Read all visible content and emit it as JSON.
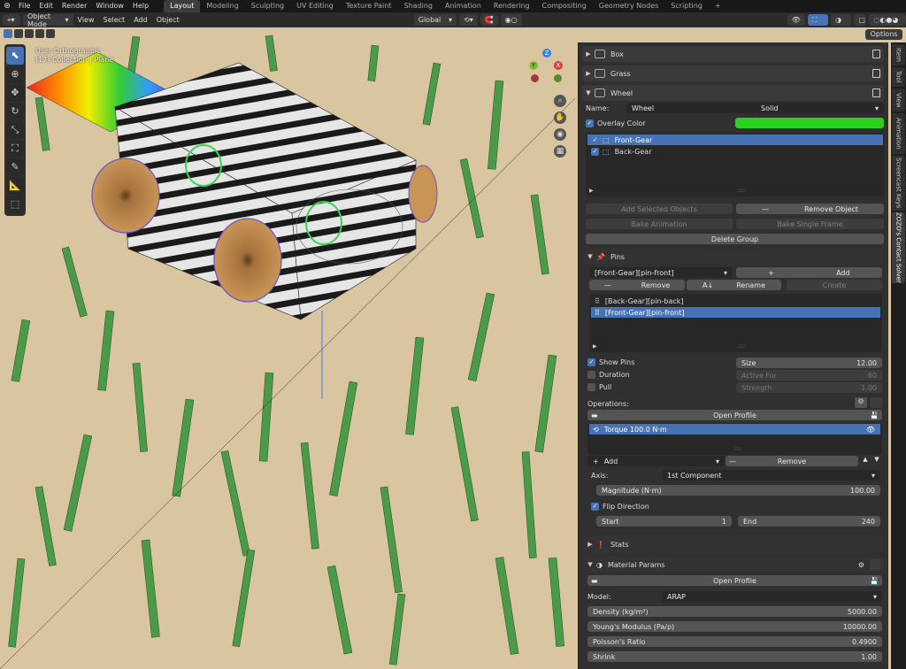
{
  "menubar": {
    "menus": [
      "File",
      "Edit",
      "Render",
      "Window",
      "Help"
    ],
    "workspaces": [
      "Layout",
      "Modeling",
      "Sculpting",
      "UV Editing",
      "Texture Paint",
      "Shading",
      "Animation",
      "Rendering",
      "Compositing",
      "Geometry Nodes",
      "Scripting"
    ],
    "active_workspace": "Layout",
    "add_tab": "+"
  },
  "header": {
    "mode": "Object Mode",
    "menus": [
      "View",
      "Select",
      "Add",
      "Object"
    ],
    "orientation": "Global",
    "options": "Options"
  },
  "viewport": {
    "view_name": "User Orthographic",
    "collection": "(17) Collection | Plane",
    "gizmo": {
      "x": "X",
      "y": "Y",
      "z": "Z"
    },
    "colors": {
      "ground": "#d9c6a0",
      "grass": "#3f8f3f",
      "wood": "#b8874e",
      "selection": "#39d353"
    }
  },
  "right_tabs": [
    "Item",
    "Tool",
    "View",
    "Animation",
    "Screencast Keys",
    "ZOZO's Contact Solver"
  ],
  "panel": {
    "groups": [
      {
        "label": "Box"
      },
      {
        "label": "Grass"
      },
      {
        "label": "Wheel"
      }
    ],
    "name_label": "Name:",
    "name_value": "Wheel",
    "shading_value": "Solid",
    "overlay_label": "Overlay Color",
    "overlay_color": "#2bd11c",
    "objects": [
      {
        "label": "Front-Gear",
        "selected": true
      },
      {
        "label": "Back-Gear",
        "selected": false
      }
    ],
    "list_grip": "::::",
    "add_selected": "Add Selected Objects",
    "remove_object": "Remove Object",
    "bake_animation": "Bake Animation",
    "bake_single": "Bake Single Frame",
    "delete_group": "Delete Group",
    "pins": {
      "title": "Pins",
      "selected": "[Front-Gear][pin-front]",
      "add": "Add",
      "remove": "Remove",
      "rename": "Rename",
      "create": "Create",
      "items": [
        {
          "label": "[Back-Gear][pin-back]",
          "selected": false
        },
        {
          "label": "[Front-Gear][pin-front]",
          "selected": true
        }
      ]
    },
    "show_pins": "Show Pins",
    "size_label": "Size",
    "size_value": "12.00",
    "duration": "Duration",
    "active_for": "Active For",
    "active_for_value": "60",
    "pull": "Pull",
    "strength": "Strength",
    "strength_value": "1.00",
    "operations_label": "Operations:",
    "open_profile": "Open Profile",
    "operation": "Torque 100.0 N·m",
    "op_add": "Add",
    "op_remove": "Remove",
    "axis_label": "Axis:",
    "axis_value": "1st Component",
    "magnitude_label": "Magnitude (N·m)",
    "magnitude_value": "100.00",
    "flip": "Flip Direction",
    "start_label": "Start",
    "start_value": "1",
    "end_label": "End",
    "end_value": "240",
    "stats": "Stats",
    "material": "Material Params",
    "open_profile2": "Open Profile",
    "model_label": "Model:",
    "model_value": "ARAP",
    "params": [
      {
        "label": "Density (kg/m³)",
        "value": "5000.00"
      },
      {
        "label": "Young's Modulus (Pa/ρ)",
        "value": "10000.00"
      },
      {
        "label": "Poisson's Ratio",
        "value": "0.4900"
      },
      {
        "label": "Shrink",
        "value": "1.00"
      }
    ]
  }
}
